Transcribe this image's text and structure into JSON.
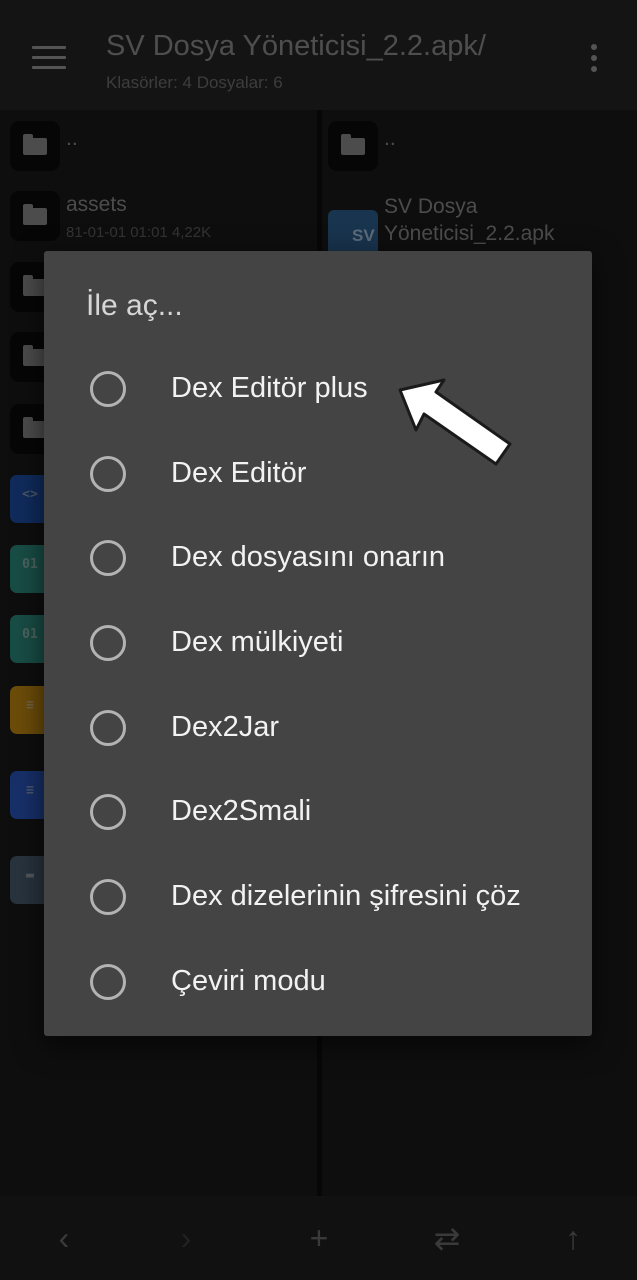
{
  "header": {
    "title": "SV Dosya Yöneticisi_2.2.apk/",
    "subtitle": "Klasörler: 4  Dosyalar: 6"
  },
  "left_pane": {
    "parent": "..",
    "assets_name": "assets",
    "assets_meta": "81-01-01 01:01  4,22K"
  },
  "right_pane": {
    "parent": "..",
    "apk_name": "SV Dosya Yöneticisi_2.2.apk",
    "apk_icon_text": "SV"
  },
  "dialog": {
    "title": "İle aç...",
    "options": [
      {
        "label": "Dex Editör plus"
      },
      {
        "label": "Dex Editör"
      },
      {
        "label": "Dex dosyasını onarın"
      },
      {
        "label": "Dex mülkiyeti"
      },
      {
        "label": "Dex2Jar"
      },
      {
        "label": "Dex2Smali"
      },
      {
        "label": "Dex dizelerinin şifresini çöz"
      },
      {
        "label": "Çeviri modu"
      }
    ]
  },
  "bottom_bar": {
    "back": "‹",
    "forward": "›",
    "add": "+",
    "swap": "⇄",
    "up": "↑"
  },
  "colors": {
    "dialog_bg": "#444444",
    "app_bg": "#161616",
    "apk_icon": "#2e5f8f"
  }
}
